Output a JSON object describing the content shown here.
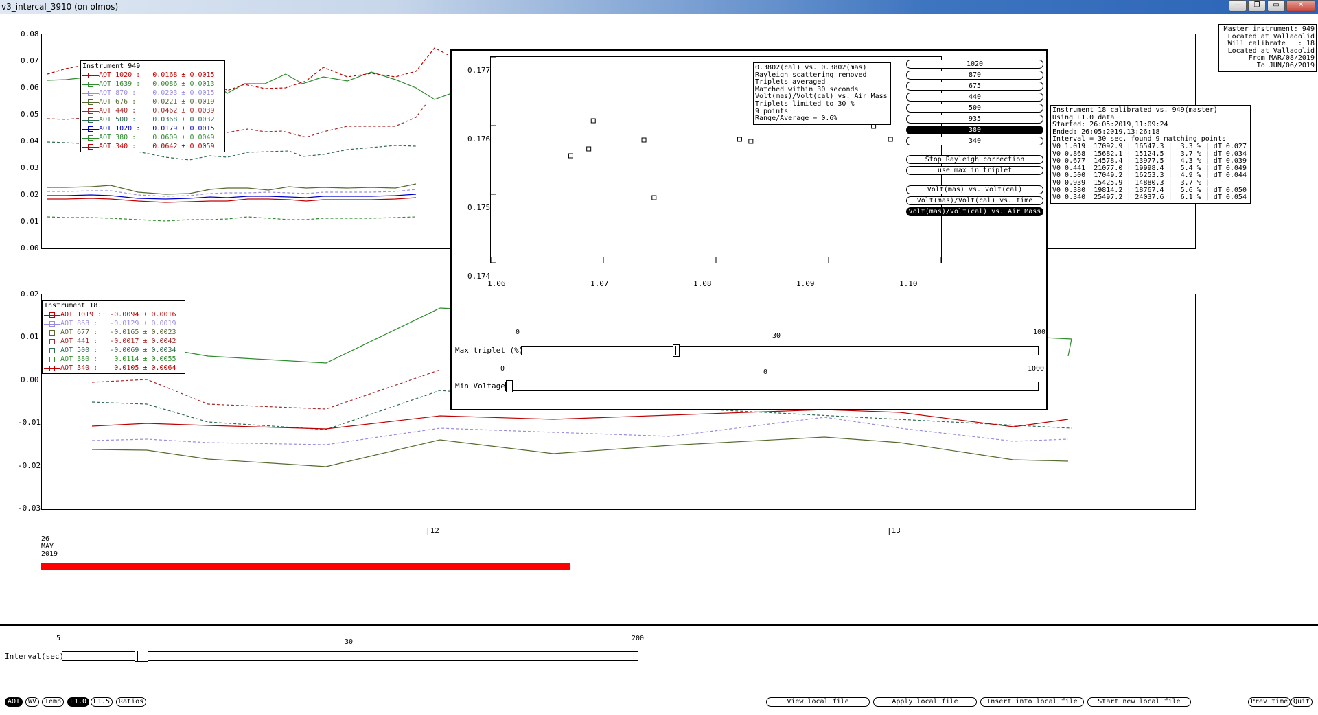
{
  "window": {
    "title": "v3_intercal_3910 (on olmos)",
    "btn_min": "—",
    "btn_max": "▭",
    "btn_restore": "❐",
    "btn_close": "✕"
  },
  "top_plot": {
    "yticks": [
      "0.08",
      "0.07",
      "0.06",
      "0.05",
      "0.04",
      "0.03",
      "0.02",
      "0.01",
      "0.00"
    ],
    "legend_title": "Instrument 949",
    "legend": [
      {
        "label": "AOT 1020 :   0.0168 ± 0.0015",
        "color": "#c00000"
      },
      {
        "label": "AOT 1639 :   0.0086 ± 0.0013",
        "color": "#2e8b2e"
      },
      {
        "label": "AOT 870 :    0.0203 ± 0.0015",
        "color": "#9a8ce0"
      },
      {
        "label": "AOT 676 :    0.0221 ± 0.0019",
        "color": "#556b2f"
      },
      {
        "label": "AOT 440 :    0.0462 ± 0.0039",
        "color": "#a52a2a"
      },
      {
        "label": "AOT 500 :    0.0368 ± 0.0032",
        "color": "#2e6b4f"
      },
      {
        "label": "AOT 1020 :   0.0179 ± 0.0015",
        "color": "#0000cc"
      },
      {
        "label": "AOT 380 :    0.0609 ± 0.0049",
        "color": "#2e8b2e"
      },
      {
        "label": "AOT 340 :    0.0642 ± 0.0059",
        "color": "#c00000"
      }
    ]
  },
  "bottom_plot": {
    "yticks": [
      "0.02",
      "0.01",
      "0.00",
      "-0.01",
      "-0.02",
      "-0.03"
    ],
    "legend_title": "Instrument 18",
    "legend": [
      {
        "label": "AOT 1019 :  -0.0094 ± 0.0016",
        "color": "#c00000"
      },
      {
        "label": "AOT 868 :   -0.0129 ± 0.0019",
        "color": "#9a8ce0"
      },
      {
        "label": "AOT 677 :   -0.0165 ± 0.0023",
        "color": "#556b2f"
      },
      {
        "label": "AOT 441 :   -0.0017 ± 0.0042",
        "color": "#a52a2a"
      },
      {
        "label": "AOT 500 :   -0.0069 ± 0.0034",
        "color": "#2e6b4f"
      },
      {
        "label": "AOT 380 :    0.0114 ± 0.0055",
        "color": "#2e8b2e"
      },
      {
        "label": "AOT 340 :    0.0105 ± 0.0064",
        "color": "#c00000"
      }
    ],
    "x_day_label_1": "26",
    "x_day_label_2": "MAY",
    "x_day_label_3": "2019",
    "x_hour_12": "|12",
    "x_hour_13": "|13"
  },
  "master_box": "Master instrument: 949\nLocated at Valladolid\nWill calibrate   : 18\nLocated at Valladolid\n      From MAR/08/2019\n        To JUN/06/2019",
  "calib_box": "Instrument 18 calibrated vs. 949(master)\nUsing L1.0 data\nStarted: 26:05:2019,11:09:24\nEnded: 26:05:2019,13:26:18\nInterval = 30 sec, found 9 matching points\nV0 1.019  17092.9 | 16547.3 |  3.3 % | dT 0.027\nV0 0.868  15682.1 | 15124.5 |  3.7 % | dT 0.034\nV0 0.677  14578.4 | 13977.5 |  4.3 % | dT 0.039\nV0 0.441  21077.0 | 19998.4 |  5.4 % | dT 0.049\nV0 0.500  17049.2 | 16253.3 |  4.9 % | dT 0.044\nV0 0.939  15425.9 | 14880.3 |  3.7 % |\nV0 0.380  19814.2 | 18767.4 |  5.6 % | dT 0.050\nV0 0.340  25497.2 | 24037.6 |  6.1 % | dT 0.054",
  "popup": {
    "info": "0.3802(cal) vs. 0.3802(mas)\nRayleigh scattering removed\nTriplets averaged\nMatched within 30 seconds\nVolt(mas)/Volt(cal) vs. Air Mass\nTriplets limited to 30 %\n9 points\nRange/Average = 0.6%",
    "wavelength_buttons": [
      {
        "label": "1020",
        "on": false
      },
      {
        "label": "870",
        "on": false
      },
      {
        "label": "675",
        "on": false
      },
      {
        "label": "440",
        "on": false
      },
      {
        "label": "500",
        "on": false
      },
      {
        "label": "935",
        "on": false
      },
      {
        "label": "380",
        "on": true
      },
      {
        "label": "340",
        "on": false
      }
    ],
    "btn_stop_rayleigh": "Stop Rayleigh correction",
    "btn_use_max": "use max in triplet",
    "btn_volt": "Volt(mas) vs. Volt(cal)",
    "btn_volt_time": "Volt(mas)/Volt(cal) vs. time",
    "btn_volt_airmass": "Volt(mas)/Volt(cal) vs. Air Mass",
    "chart_yticks": [
      "0.177",
      "0.176",
      "0.175",
      "0.174"
    ],
    "chart_xticks": [
      "1.06",
      "1.07",
      "1.08",
      "1.09",
      "1.10"
    ],
    "slider1_label": "Max triplet (%)",
    "slider1_min": "0",
    "slider1_value": "30",
    "slider1_max": "100",
    "slider2_label": "Min Voltage",
    "slider2_min": "0",
    "slider2_value": "0",
    "slider2_max": "1000"
  },
  "chart_data": {
    "type": "scatter",
    "xlim": [
      1.06,
      1.1
    ],
    "ylim": [
      0.174,
      0.177
    ],
    "points": [
      {
        "x": 1.0671,
        "y": 0.17556
      },
      {
        "x": 1.0687,
        "y": 0.17566
      },
      {
        "x": 1.0691,
        "y": 0.17607
      },
      {
        "x": 1.0736,
        "y": 0.17579
      },
      {
        "x": 1.0745,
        "y": 0.17495
      },
      {
        "x": 1.0821,
        "y": 0.1758
      },
      {
        "x": 1.0831,
        "y": 0.17577
      },
      {
        "x": 1.094,
        "y": 0.17599
      },
      {
        "x": 1.0955,
        "y": 0.1758
      }
    ]
  },
  "interval_slider": {
    "label": "Interval(sec)",
    "min": "5",
    "value": "30",
    "max": "200"
  },
  "bottom_toggles": [
    {
      "label": "AOT",
      "on": true
    },
    {
      "label": "WV",
      "on": false
    },
    {
      "label": "Temp",
      "on": false
    },
    {
      "label": "L1.0",
      "on": true
    },
    {
      "label": "L1.5",
      "on": false
    },
    {
      "label": "Ratios",
      "on": false
    }
  ],
  "file_buttons": {
    "view": "View local file",
    "apply": "Apply local file",
    "insert": "Insert into local file",
    "start": "Start new local file"
  },
  "nav_buttons": {
    "prev": "Prev time",
    "quit": "Quit"
  }
}
